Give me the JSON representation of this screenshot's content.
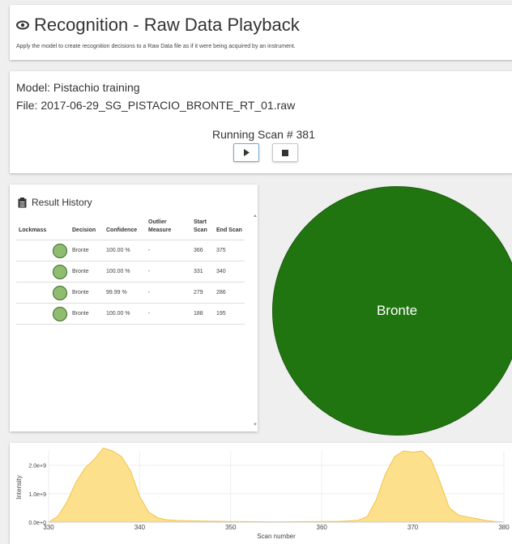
{
  "header": {
    "title": "Recognition - Raw Data Playback",
    "subtitle": "Apply the model to create recognition decisions to a Raw Data file as if it were being acquired by an instrument.",
    "icon": "eye-icon"
  },
  "info": {
    "model": "Model: Pistachio training",
    "file": "File: 2017-06-29_SG_PISTACIO_BRONTE_RT_01.raw",
    "running": "Running Scan # 381",
    "buttons": {
      "play_icon": "play-icon",
      "stop_icon": "stop-icon"
    }
  },
  "history": {
    "title": "Result History",
    "icon": "clipboard-icon",
    "columns": [
      "Lockmass",
      "Decision",
      "Confidence",
      "Outlier Measure",
      "Start Scan",
      "End Scan"
    ],
    "rows": [
      {
        "decision": "Bronte",
        "confidence": "100.00 %",
        "outlier": "-",
        "start": "366",
        "end": "375"
      },
      {
        "decision": "Bronte",
        "confidence": "100.00 %",
        "outlier": "-",
        "start": "331",
        "end": "340"
      },
      {
        "decision": "Bronte",
        "confidence": "99.99 %",
        "outlier": "-",
        "start": "279",
        "end": "286"
      },
      {
        "decision": "Bronte",
        "confidence": "100.00 %",
        "outlier": "-",
        "start": "188",
        "end": "195"
      }
    ]
  },
  "decision": {
    "label": "Bronte",
    "color": "#217511"
  },
  "colors": {
    "fill": "#fde08c",
    "line": "#f3c34a",
    "dot_fill": "#8fbc6f"
  },
  "chart_data": {
    "type": "area",
    "xlabel": "Scan number",
    "ylabel": "Intensity",
    "xlim": [
      330,
      380
    ],
    "ylim": [
      0,
      2500000000
    ],
    "x_ticks": [
      330,
      340,
      350,
      360,
      370,
      380
    ],
    "y_ticks": [
      0,
      1000000000,
      2000000000
    ],
    "y_tick_labels": [
      "0.0e+0",
      "1.0e+9",
      "2.0e+9"
    ],
    "series": [
      {
        "x": [
          330,
          331,
          332,
          333,
          334,
          335,
          336,
          337,
          338,
          339,
          340,
          341,
          342,
          343,
          344,
          345,
          350,
          355,
          360,
          362,
          364,
          365,
          366,
          367,
          368,
          369,
          370,
          371,
          372,
          373,
          374,
          375,
          376,
          377,
          378,
          379,
          380
        ],
        "y": [
          0,
          200000000,
          700000000,
          1400000000,
          1900000000,
          2200000000,
          2600000000,
          2500000000,
          2300000000,
          1800000000,
          900000000,
          350000000,
          150000000,
          80000000,
          60000000,
          50000000,
          20000000,
          10000000,
          20000000,
          30000000,
          60000000,
          200000000,
          800000000,
          1700000000,
          2300000000,
          2500000000,
          2450000000,
          2500000000,
          2200000000,
          1400000000,
          500000000,
          250000000,
          180000000,
          120000000,
          60000000,
          20000000,
          0
        ]
      }
    ]
  }
}
